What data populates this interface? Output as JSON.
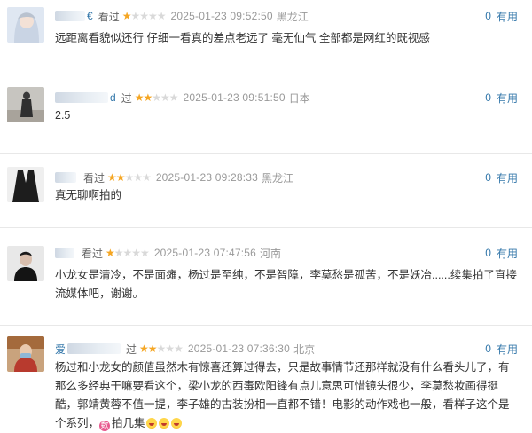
{
  "reviews": [
    {
      "name_tail": "€",
      "status": "看过",
      "rating": 1,
      "time": "2025-01-23 09:52:50",
      "location": "黑龙江",
      "useful_count": "0",
      "useful_label": "有用",
      "text": "远距离看貌似还行 仔细一看真的差点老远了 毫无仙气 全部都是网红的既视感"
    },
    {
      "name_tail": "d",
      "status": "过",
      "rating": 2,
      "time": "2025-01-23 09:51:50",
      "location": "日本",
      "useful_count": "0",
      "useful_label": "有用",
      "text": "2.5"
    },
    {
      "name_tail": "",
      "status": "看过",
      "rating": 2,
      "time": "2025-01-23 09:28:33",
      "location": "黑龙江",
      "useful_count": "0",
      "useful_label": "有用",
      "text": "真无聊啊拍的"
    },
    {
      "name_tail": "",
      "status": "看过",
      "rating": 1,
      "time": "2025-01-23 07:47:56",
      "location": "河南",
      "useful_count": "0",
      "useful_label": "有用",
      "text": "小龙女是清冷，不是面瘫，杨过是至纯，不是智障，李莫愁是孤苦，不是妖冶......续集拍了直接流媒体吧，谢谢。"
    },
    {
      "name_tail": "爱",
      "status": "过",
      "rating": 2,
      "time": "2025-01-23 07:36:30",
      "location": "北京",
      "useful_count": "0",
      "useful_label": "有用",
      "text": "杨过和小龙女的颜值虽然木有惊喜还算过得去，只是故事情节还那样就没有什么看头儿了，有那么多经典干嘛要看这个，梁小龙的西毒欧阳锋有点儿意思可惜镜头很少，李莫愁妆画得挺酷，郭靖黄蓉不值一提，李子雄的古装扮相一直都不错！电影的动作戏也一般，看样子这个是个系列，",
      "tail_badge": "数",
      "tail_text": "拍几集"
    }
  ],
  "colors": {
    "link": "#3377aa",
    "star_on": "#f5a623",
    "star_off": "#d9d9d9",
    "muted": "#999999"
  }
}
